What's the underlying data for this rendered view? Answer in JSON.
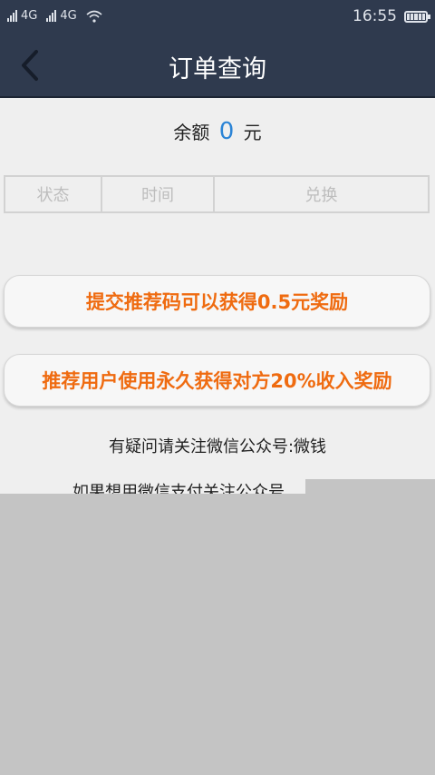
{
  "status_bar": {
    "sim1_network": "4G",
    "sim2_network": "4G",
    "time": "16:55",
    "icons": [
      "signal-icon",
      "wifi-icon",
      "battery-icon"
    ]
  },
  "navbar": {
    "title": "订单查询",
    "back_icon": "chevron-left-icon"
  },
  "balance": {
    "label": "余额",
    "amount": "0",
    "unit": "元"
  },
  "table": {
    "columns": [
      "状态",
      "时间",
      "兑换"
    ]
  },
  "buttons": {
    "submit_referral": "提交推荐码可以获得0.5元奖励",
    "referral_reward": "推荐用户使用永久获得对方20%收入奖励"
  },
  "info": {
    "line1": "有疑问请关注微信公众号:微钱",
    "line2": "如果想用微信支付关注公众号"
  },
  "colors": {
    "header_bg": "#2f3a4e",
    "accent_orange": "#ef6b10",
    "amount_blue": "#2b84d6",
    "page_bg": "#efefef"
  }
}
